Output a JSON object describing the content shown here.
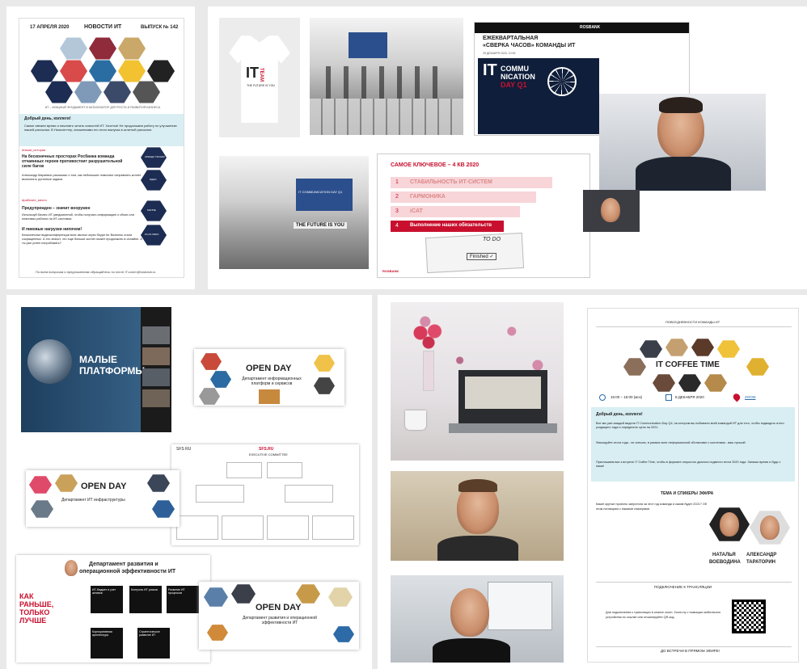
{
  "newsletter": {
    "date": "17 АПРЕЛЯ 2020",
    "title": "НОВОСТИ ИТ",
    "issue": "ВЫПУСК № 142",
    "tagline": "ИТ – МОЩНЫЙ ФУНДАМЕНТ И КАТАЛИЗАТОР ДЛЯ РОСТА И РАЗВИТИЯ БИЗНЕСА",
    "greeting": "Добрый день, коллеги!",
    "intro": "Самое свежее время и начинать читать новостей ИТ. Хочется! Не продолжаем работу по улучшению нашей рассылки. В Ньюслеттер, вложениями его этого выпуска в штатной рассылке.",
    "section1_tag": "#наши_истории",
    "section1_title": "На бесконечных просторах Росбанка команда отчаянных героев противостоит разрушительной силе багов",
    "section1_body": "Александр Маркевич рассказал о том, как небольшие помогают исправлять коллег выполнять рутинные задачи.",
    "section2_tag": "#рабочее_место",
    "section2_title": "Предупрежден – значит вооружен",
    "section2_body": "Используй бизнес ИТ-уведомлений, чтобы получать информацию о сбоях или плановых работах на ИТ-системах.",
    "section3_title": "И пиковые нагрузки нипочем!",
    "section3_body": "Бесконечные видеоконференции всех звонок через Skype for Business стали сокращенных. А это значит, что еще больше коллег может продолжить в онлайне. А ты уже успел попробовать?",
    "footer": "По всем вопросам и предложениям обращайтесь по почте IT.comm@rosbank.ru",
    "chips": [
      "АРЕНДА ТЕХНИК",
      "ИДЕИ",
      "МАППЕ",
      "PLUS ОФИС"
    ]
  },
  "tshirt": {
    "brand": "IT",
    "word": "TEAM",
    "sub": "THE FUTURE IS YOU"
  },
  "event_slide": {
    "title_line1": "ЕЖЕКВАРТАЛЬНАЯ",
    "title_line2": "«СВЕРКА ЧАСОВ» КОМАНДЫ ИТ",
    "date": "25 ДЕКАБРЯ 2020, 10:00",
    "brand_big_1": "IT",
    "brand_big_2": "COMMU",
    "brand_big_3": "NICATION",
    "brand_big_4": "DAY Q1",
    "brand_small": "ROSBANK"
  },
  "stage": {
    "screen_text": "IT COMMUNICATION DAY Q1",
    "banner": "THE FUTURE IS YOU"
  },
  "key_slide": {
    "title": "САМОЕ КЛЮЧЕВОЕ – 4 КВ 2020",
    "items": [
      {
        "n": "1",
        "text": "СТАБИЛЬНОСТЬ ИТ-СИСТЕМ"
      },
      {
        "n": "2",
        "text": "ГАРМОНИКА"
      },
      {
        "n": "3",
        "text": "iCAT"
      },
      {
        "n": "4",
        "text": "Выполнение наших обязательств"
      }
    ],
    "todo": "TO DO",
    "finished": "Finished ✓",
    "brand": "ROSBANK"
  },
  "platforms": {
    "title_line1": "МАЛЫЕ",
    "title_line2": "ПЛАТФОРМЫ"
  },
  "open_day_1": {
    "title": "OPEN DAY",
    "subtitle": "Департамент информационных платформ и сервисов"
  },
  "open_day_2": {
    "title": "OPEN DAY",
    "subtitle": "Департамент ИТ инфраструктуры"
  },
  "open_day_3": {
    "title": "OPEN DAY",
    "subtitle": "Департамент развития и операционной эффективности ИТ"
  },
  "org": {
    "logo": "SFS RU",
    "header": "SFS.RU",
    "committee": "EXECUTIVE COMMITTEE"
  },
  "dept": {
    "title_line1": "Департамент развития и",
    "title_line2": "операционной эффективности ИТ",
    "slogan_1": "КАК",
    "slogan_2": "РАНЬШЕ,",
    "slogan_3": "ТОЛЬКО",
    "slogan_4": "ЛУЧШЕ",
    "boxes": [
      "ИТ-бюджет и учет активов",
      "Контроль ИТ рисков",
      "Развитие ИТ процессов",
      "Корпоративная архитектура",
      "Стратегическое развитие ИТ"
    ]
  },
  "coffee": {
    "topline": "ПОВСЕДНЕВНОСТИ КОМАНДЫ ИТ",
    "title": "IT COFFEE TIME",
    "time": "15:00 – 16:00 (мск)",
    "date": "8 ДЕКАБРЯ 2020",
    "place": "ZOOM",
    "greeting": "Добрый день, коллеги!",
    "p1": "Все мы уже каждый видели IT Communication Day Q4, на котором вы побывали всей командой ИТ для того, чтобы подводить итоги уходящего года и определить цели на 2021.",
    "p2": "Фиксируйте итоги года - не спешно, в рамках всех неформальной обстановке с коллегами - ваш лучший",
    "p3": "Приглашаем вас к встрече IT Coffee Time, чтобы в формате открытого диалога подвести итоги 2020 года. Запиши время и будь с нами!",
    "topics_title": "ТЕМА И СПИКЕРЫ ЭФИРА",
    "topics_body": "Какие крутые проекты запустила за этот год команда и каким будет 2021? Об этом поговорим с нашими спикерами.",
    "speaker1_first": "НАТАЛЬЯ",
    "speaker1_last": "ВОЕВОДИНА",
    "speaker2_first": "АЛЕКСАНДР",
    "speaker2_last": "ТАРАТОРИН",
    "join_title": "ПОДКЛЮЧЕНИЕ К ТРАНСЛЯЦИИ",
    "join_body": "Для подключения к трансляции в сеансе zoom: Zoom-ну с помощью мобильного устройства по ссылке или отсканируйте QR-код.",
    "bottom": "ДО ВСТРЕЧИ В ПРЯМОМ ЭФИРЕ!"
  },
  "colors": {
    "brand_red": "#c8102e",
    "navy": "#14234a",
    "light_blue_band": "#d8eef3"
  }
}
